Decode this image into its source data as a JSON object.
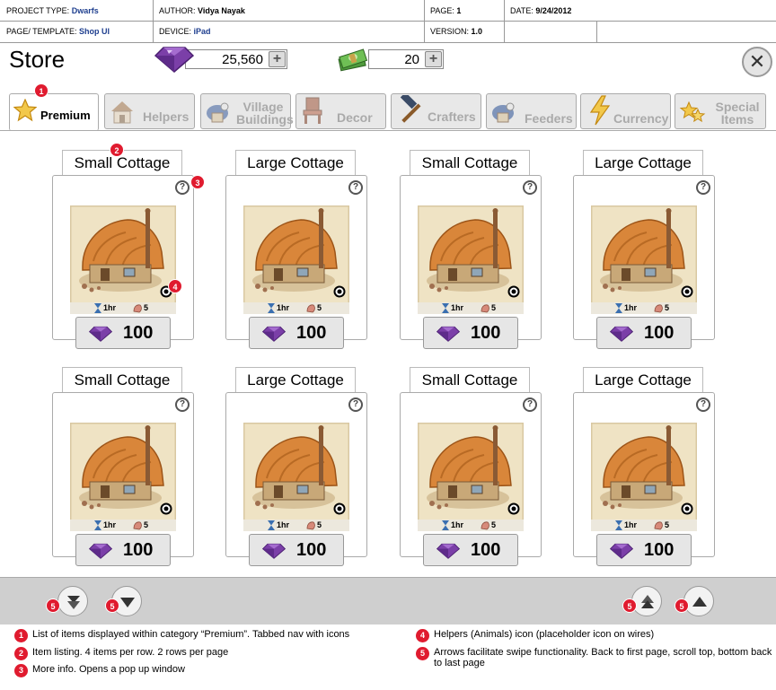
{
  "spec": {
    "project_type_label": "PROJECT TYPE:",
    "project_type": "Dwarfs",
    "author_label": "AUTHOR:",
    "author": "Vidya Nayak",
    "page_label": "PAGE:",
    "page": "1",
    "date_label": "DATE:",
    "date": "9/24/2012",
    "template_label": "PAGE/ TEMPLATE:",
    "template": "Shop UI",
    "device_label": "DEVICE:",
    "device": "iPad",
    "version_label": "VERSION:",
    "version": "1.0"
  },
  "store": {
    "title": "Store",
    "gems": "25,560",
    "cash": "20",
    "plus": "+",
    "close": "✕"
  },
  "tabs": [
    {
      "label": "Premium",
      "icon": "star-icon"
    },
    {
      "label": "Helpers",
      "icon": "helper-hut-icon"
    },
    {
      "label": "Village Buildings",
      "icon": "village-building-icon"
    },
    {
      "label": "Decor",
      "icon": "decor-chair-icon"
    },
    {
      "label": "Crafters",
      "icon": "hammer-icon"
    },
    {
      "label": "Feeders",
      "icon": "feeder-icon"
    },
    {
      "label": "Currency",
      "icon": "lightning-icon"
    },
    {
      "label": "Special Items",
      "icon": "stars-icon"
    }
  ],
  "items": [
    {
      "name": "Small Cottage",
      "time": "1hr",
      "helpers": "5",
      "price": "100"
    },
    {
      "name": "Large Cottage",
      "time": "1hr",
      "helpers": "5",
      "price": "100"
    },
    {
      "name": "Small Cottage",
      "time": "1hr",
      "helpers": "5",
      "price": "100"
    },
    {
      "name": "Large Cottage",
      "time": "1hr",
      "helpers": "5",
      "price": "100"
    },
    {
      "name": "Small Cottage",
      "time": "1hr",
      "helpers": "5",
      "price": "100"
    },
    {
      "name": "Large Cottage",
      "time": "1hr",
      "helpers": "5",
      "price": "100"
    },
    {
      "name": "Small Cottage",
      "time": "1hr",
      "helpers": "5",
      "price": "100"
    },
    {
      "name": "Large Cottage",
      "time": "1hr",
      "helpers": "5",
      "price": "100"
    }
  ],
  "help_glyph": "?",
  "badges": [
    "1",
    "2",
    "3",
    "4",
    "5"
  ],
  "notes": [
    {
      "num": "1",
      "text": "List of items displayed within category  “Premium”. Tabbed nav with icons"
    },
    {
      "num": "2",
      "text": "Item listing. 4 items per row. 2 rows per page"
    },
    {
      "num": "3",
      "text": "More info. Opens a pop up window"
    },
    {
      "num": "4",
      "text": "Helpers (Animals) icon (placeholder icon on wires)"
    },
    {
      "num": "5",
      "text": "Arrows facilitate swipe functionality. Back to first page, scroll top, bottom back to last page"
    }
  ],
  "colors": {
    "accent_blue": "#1f3f8f",
    "badge_red": "#e01b2f",
    "gem_purple": "#7b3fa8",
    "footer_gray": "#cfcfcf"
  }
}
